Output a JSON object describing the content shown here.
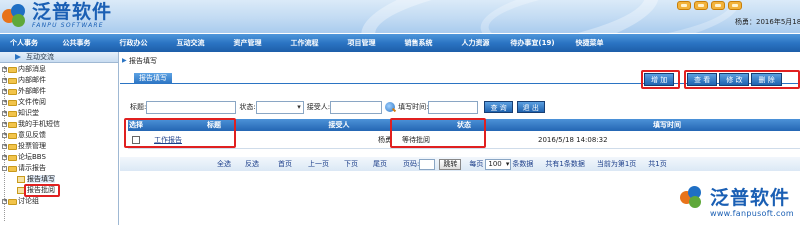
{
  "brand": {
    "name_cn": "泛普软件",
    "name_en": "FANPU SOFTWARE",
    "watermark_cn": "泛普软件",
    "watermark_url": "www.fanpusoft.com"
  },
  "header": {
    "user": "杨勇",
    "date": "2016年5月18日"
  },
  "nav": {
    "items": [
      "个人事务",
      "公共事务",
      "行政办公",
      "互动交流",
      "资产管理",
      "工作流程",
      "项目管理",
      "销售系统",
      "人力资源",
      "待办事宜(19)",
      "快捷菜单"
    ]
  },
  "sidebar": {
    "header": "互动交流",
    "items": [
      {
        "label": "内部消息",
        "pm": "+"
      },
      {
        "label": "内部邮件",
        "pm": "+"
      },
      {
        "label": "外部邮件",
        "pm": "+"
      },
      {
        "label": "文件传阅",
        "pm": "+"
      },
      {
        "label": "知识堂",
        "pm": "+"
      },
      {
        "label": "我的手机短信",
        "pm": "+"
      },
      {
        "label": "意见反馈",
        "pm": "+"
      },
      {
        "label": "投票管理",
        "pm": "+"
      },
      {
        "label": "论坛BBS",
        "pm": "+"
      },
      {
        "label": "请示报告",
        "pm": "-"
      }
    ],
    "sub_items": [
      {
        "label": "报告填写"
      },
      {
        "label": "报告批阅"
      }
    ],
    "last_item": {
      "label": "讨论组",
      "pm": "+"
    }
  },
  "main": {
    "breadcrumb": "报告填写",
    "tab": "报告填写",
    "actions": {
      "add": "增 加",
      "view": "查 看",
      "edit": "修 改",
      "delete": "删 除"
    },
    "filters": {
      "title_label": "标题:",
      "status_label": "状态:",
      "receiver_label": "接受人:",
      "time_label": "填写时间:",
      "query": "查 询",
      "exit": "退 出"
    },
    "table": {
      "columns": [
        "选择",
        "标题",
        "接受人",
        "状态",
        "填写时间"
      ],
      "rows": [
        {
          "title": "工作报告",
          "receiver": "杨勇",
          "status": "等待批阅",
          "time": "2016/5/18 14:08:32"
        }
      ]
    },
    "pager": {
      "all": "全选",
      "invert": "反选",
      "first": "首页",
      "prev": "上一页",
      "next": "下页",
      "last": "尾页",
      "page_label": "页码:",
      "jump": "跳转",
      "per_page_prefix": "每页",
      "per_page": "100",
      "per_page_suffix": "条数据",
      "total": "共有1条数据",
      "current": "当前为第1页",
      "total_pages": "共1页"
    }
  },
  "colors": {
    "accent": "#2b74c3",
    "highlight_box": "#e02020"
  }
}
